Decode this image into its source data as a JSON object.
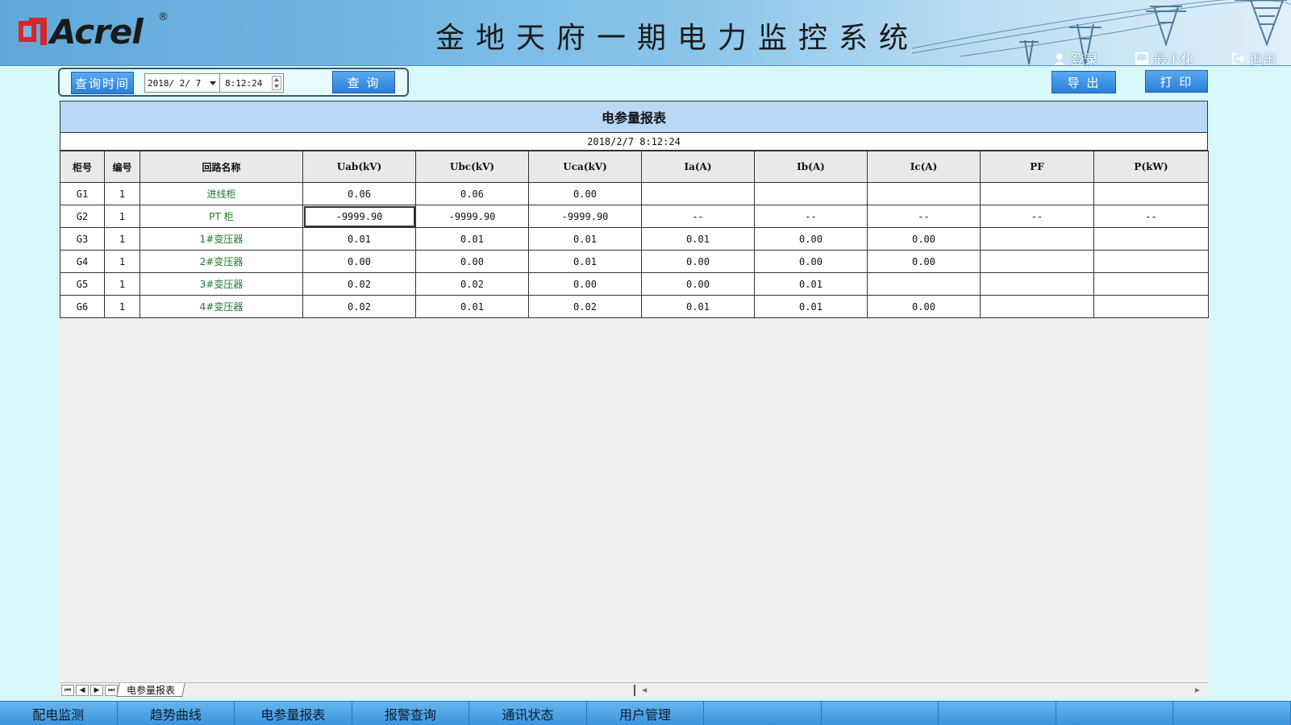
{
  "header": {
    "logo_text": "Acrel",
    "logo_reg": "®",
    "title": "金地天府一期电力监控系统",
    "actions": [
      {
        "label": "登录",
        "icon": "user-icon"
      },
      {
        "label": "最小化",
        "icon": "minimize-icon"
      },
      {
        "label": "退出",
        "icon": "exit-icon"
      }
    ]
  },
  "query": {
    "label": "查询时间",
    "date": "2018/ 2/ 7",
    "time": "8:12:24",
    "search_button": "查 询"
  },
  "toolbar": {
    "export_button": "导 出",
    "print_button": "打 印"
  },
  "report": {
    "title": "电参量报表",
    "timestamp": "2018/2/7 8:12:24",
    "columns": [
      "柜号",
      "编号",
      "回路名称",
      "Uab(kV)",
      "Ubc(kV)",
      "Uca(kV)",
      "Ia(A)",
      "Ib(A)",
      "Ic(A)",
      "PF",
      "P(kW)"
    ],
    "rows": [
      [
        "G1",
        "1",
        "进线柜",
        "0.06",
        "0.06",
        "0.00",
        "",
        "",
        "",
        "",
        ""
      ],
      [
        "G2",
        "1",
        "PT 柜",
        "-9999.90",
        "-9999.90",
        "-9999.90",
        "--",
        "--",
        "--",
        "--",
        "--"
      ],
      [
        "G3",
        "1",
        "1#变压器",
        "0.01",
        "0.01",
        "0.01",
        "0.01",
        "0.00",
        "0.00",
        "",
        ""
      ],
      [
        "G4",
        "1",
        "2#变压器",
        "0.00",
        "0.00",
        "0.01",
        "0.00",
        "0.00",
        "0.00",
        "",
        ""
      ],
      [
        "G5",
        "1",
        "3#变压器",
        "0.02",
        "0.02",
        "0.00",
        "0.00",
        "0.01",
        "",
        "",
        ""
      ],
      [
        "G6",
        "1",
        "4#变压器",
        "0.02",
        "0.01",
        "0.02",
        "0.01",
        "0.01",
        "0.00",
        "",
        ""
      ]
    ]
  },
  "sheet": {
    "tab_label": "电参量报表",
    "nav": [
      "⏮",
      "◀",
      "▶",
      "⏭"
    ]
  },
  "bottom_nav": [
    "配电监测",
    "趋势曲线",
    "电参量报表",
    "报警查询",
    "通讯状态",
    "用户管理",
    "",
    "",
    "",
    "",
    ""
  ],
  "colors": {
    "header_blue": "#72b7e3",
    "button_blue": "#2a7fd8",
    "table_header": "#b7d8f7",
    "name_green": "#1e7a2a",
    "background": "#d8f7f9"
  }
}
